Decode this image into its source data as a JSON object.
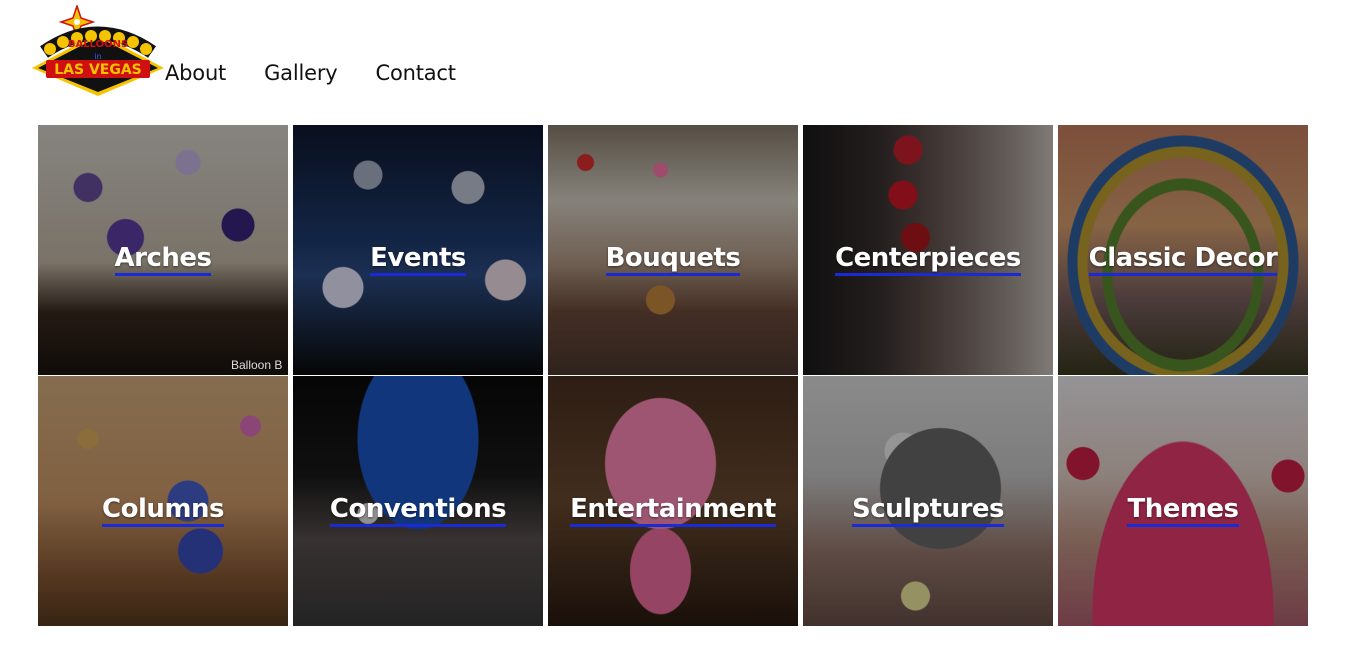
{
  "logo": {
    "line1": "BALLOONS",
    "line2": "in",
    "line3": "LAS VEGAS"
  },
  "nav": [
    {
      "label": "About"
    },
    {
      "label": "Gallery"
    },
    {
      "label": "Contact"
    }
  ],
  "tiles": [
    {
      "label": "Arches",
      "watermark": "Balloon B"
    },
    {
      "label": "Events"
    },
    {
      "label": "Bouquets"
    },
    {
      "label": "Centerpieces"
    },
    {
      "label": "Classic Decor"
    },
    {
      "label": "Columns"
    },
    {
      "label": "Conventions"
    },
    {
      "label": "Entertainment"
    },
    {
      "label": "Sculptures"
    },
    {
      "label": "Themes"
    }
  ],
  "colors": {
    "link_underline": "#1a2bd6",
    "logo_red": "#d01010",
    "logo_yellow": "#f5c400"
  }
}
